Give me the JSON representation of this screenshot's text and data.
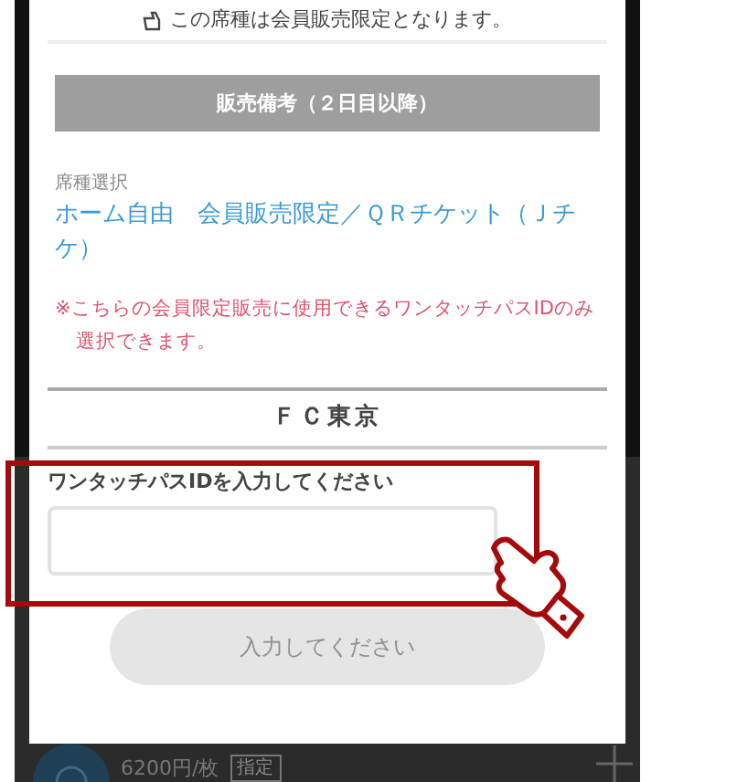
{
  "notice": {
    "text": "この席種は会員販売限定となります。"
  },
  "section_header": "販売備考（２日目以降）",
  "seat_label": "席種選択",
  "seat_link": "ホーム自由　会員販売限定／ＱＲチケット（Ｊチケ）",
  "note": "※こちらの会員限定販売に使用できるワンタッチパスIDのみ選択できます。",
  "club_name": "ＦＣ東京",
  "id_field": {
    "label": "ワンタッチパスIDを入力してください"
  },
  "submit_button": {
    "label": "入力してください",
    "disabled": true
  },
  "background_item": {
    "price": "6200円/枚",
    "tags": [
      "指定"
    ]
  }
}
